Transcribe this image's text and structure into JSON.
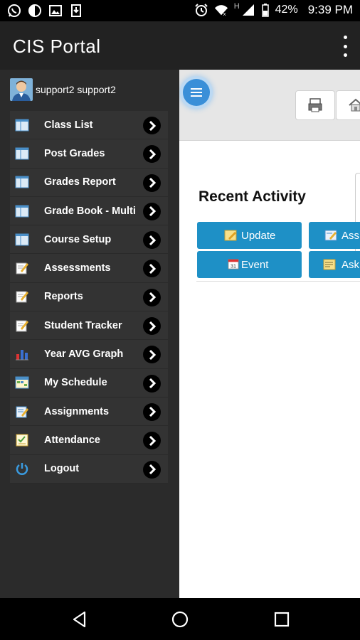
{
  "status_bar": {
    "battery": "42%",
    "time": "9:39 PM",
    "network": "H"
  },
  "app": {
    "title": "CIS Portal"
  },
  "drawer": {
    "username": "support2 support2",
    "items": [
      {
        "label": "Class List",
        "icon": "class-list-icon"
      },
      {
        "label": "Post Grades",
        "icon": "post-grades-icon"
      },
      {
        "label": "Grades Report",
        "icon": "grades-report-icon"
      },
      {
        "label": "Grade Book - Multi",
        "icon": "grade-book-icon"
      },
      {
        "label": "Course Setup",
        "icon": "course-setup-icon"
      },
      {
        "label": "Assessments",
        "icon": "assessments-icon"
      },
      {
        "label": "Reports",
        "icon": "reports-icon"
      },
      {
        "label": "Student Tracker",
        "icon": "student-tracker-icon"
      },
      {
        "label": "Year AVG Graph",
        "icon": "bar-chart-icon"
      },
      {
        "label": "My Schedule",
        "icon": "schedule-icon"
      },
      {
        "label": "Assignments",
        "icon": "assignments-icon"
      },
      {
        "label": "Attendance",
        "icon": "attendance-icon"
      },
      {
        "label": "Logout",
        "icon": "power-icon"
      }
    ]
  },
  "main": {
    "section_title": "Recent Activity",
    "actions": [
      {
        "label": "Update",
        "icon": "note-icon"
      },
      {
        "label": "Ass",
        "icon": "assign-icon"
      },
      {
        "label": "Event",
        "icon": "calendar-icon"
      },
      {
        "label": "Ask",
        "icon": "ask-icon"
      }
    ],
    "calendar_day": "31"
  },
  "colors": {
    "appbar": "#222222",
    "drawer": "#2b2b2b",
    "accent": "#1e90c6"
  }
}
